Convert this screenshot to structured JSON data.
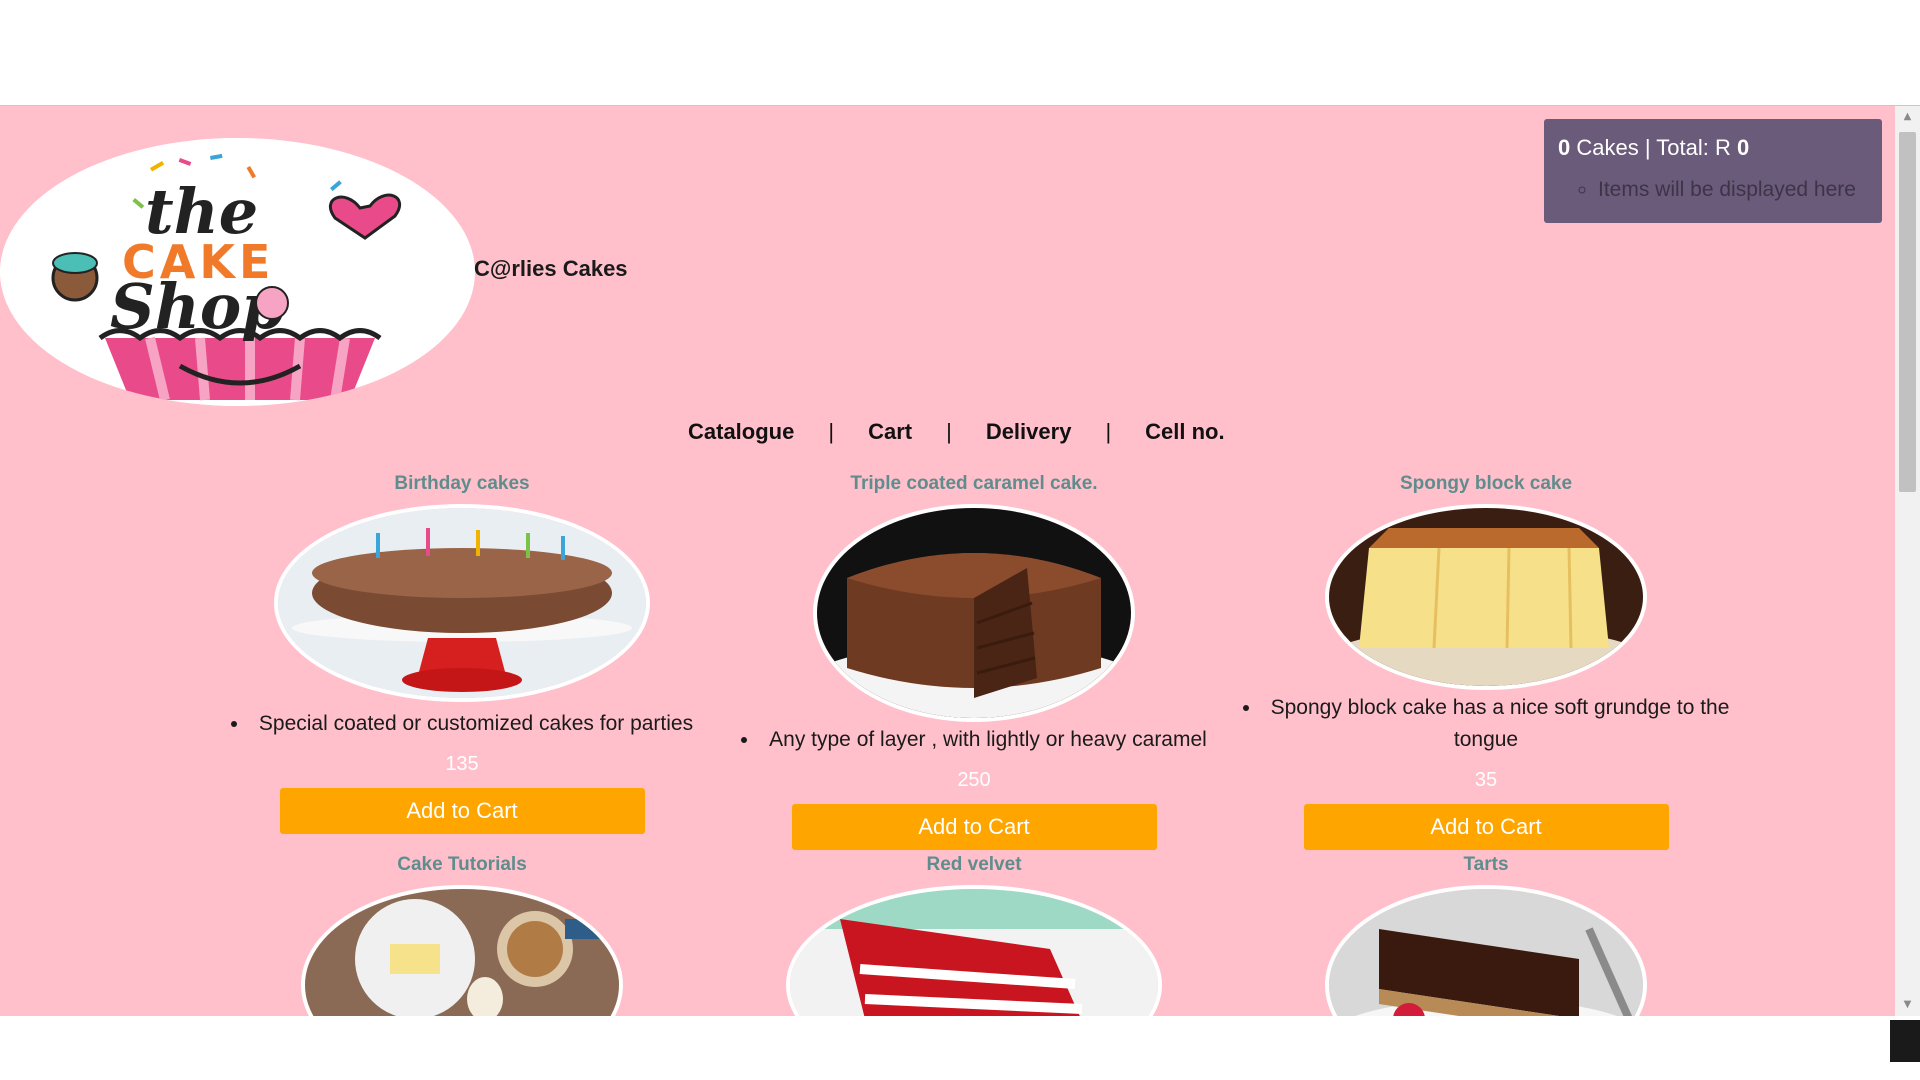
{
  "shop": {
    "name": "C@rlies Cakes",
    "logo_text": [
      "the",
      "CAKE",
      "Shop"
    ]
  },
  "cart": {
    "count": "0",
    "count_label": "Cakes | Total: R",
    "total": "0",
    "placeholder_item": "Items will be displayed here"
  },
  "nav": {
    "items": [
      "Catalogue",
      "Cart",
      "Delivery",
      "Cell no."
    ],
    "separator": "|"
  },
  "products": [
    {
      "title": "Birthday cakes",
      "description": "Special coated or customized cakes for parties",
      "price": "135",
      "button": "Add to Cart",
      "image": "birthday-cake-image"
    },
    {
      "title": "Triple coated caramel cake.",
      "description": "Any type of layer , with lightly or heavy caramel",
      "price": "250",
      "button": "Add to Cart",
      "image": "caramel-cake-image"
    },
    {
      "title": "Spongy block cake",
      "description": "Spongy block cake has a nice soft grundge to the tongue",
      "price": "35",
      "button": "Add to Cart",
      "image": "sponge-cake-image"
    },
    {
      "title": "Cake Tutorials",
      "image": "baking-ingredients-image"
    },
    {
      "title": "Red velvet",
      "image": "red-velvet-image"
    },
    {
      "title": "Tarts",
      "image": "chocolate-tart-image"
    }
  ],
  "colors": {
    "page_background": "#ffc0cb",
    "cart_box": "#6b5b7b",
    "button": "#ffa500",
    "card_title": "#5f8d8d"
  }
}
